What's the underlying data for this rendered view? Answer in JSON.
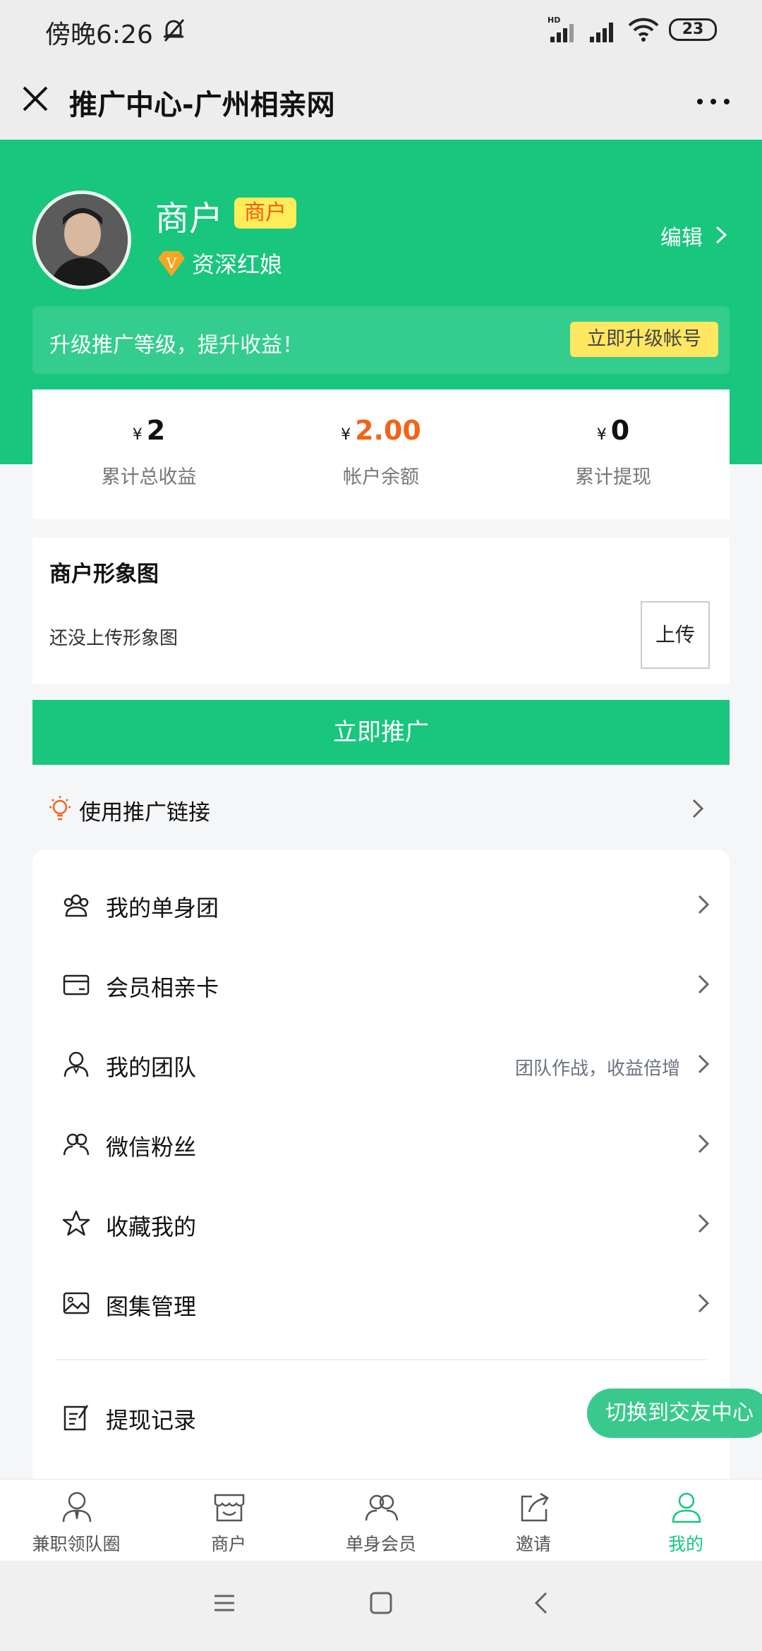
{
  "status_bar": {
    "time": "傍晚6:26",
    "battery": "23",
    "network": "HD"
  },
  "title_bar": {
    "title": "推广中心-广州相亲网"
  },
  "profile": {
    "name": "商户",
    "tag": "商户",
    "level": "资深红娘",
    "vip_badge": "V",
    "edit_label": "编辑"
  },
  "upgrade": {
    "text": "升级推广等级，提升收益！",
    "button": "立即升级帐号"
  },
  "stats": [
    {
      "currency": "¥",
      "value": "2",
      "label": "累计总收益"
    },
    {
      "currency": "¥",
      "value": "2.00",
      "label": "帐户余额"
    },
    {
      "currency": "¥",
      "value": "0",
      "label": "累计提现"
    }
  ],
  "merchant_image": {
    "title": "商户形象图",
    "empty_text": "还没上传形象图",
    "upload_button": "上传"
  },
  "promote_button": "立即推广",
  "promote_link": {
    "label": "使用推广链接",
    "icon": "lightbulb-icon"
  },
  "menu": [
    {
      "label": "我的单身团",
      "icon": "group-icon",
      "hint": ""
    },
    {
      "label": "会员相亲卡",
      "icon": "card-icon",
      "hint": ""
    },
    {
      "label": "我的团队",
      "icon": "team-icon",
      "hint": "团队作战，收益倍增"
    },
    {
      "label": "微信粉丝",
      "icon": "fans-icon",
      "hint": ""
    },
    {
      "label": "收藏我的",
      "icon": "star-icon",
      "hint": ""
    },
    {
      "label": "图集管理",
      "icon": "image-icon",
      "hint": ""
    },
    {
      "label": "提现记录",
      "icon": "record-icon",
      "hint": ""
    }
  ],
  "switch_button": "切换到交友中心",
  "tabs": [
    {
      "label": "兼职领队圈",
      "icon": "leader-icon",
      "active": false
    },
    {
      "label": "商户",
      "icon": "shop-icon",
      "active": false
    },
    {
      "label": "单身会员",
      "icon": "members-icon",
      "active": false
    },
    {
      "label": "邀请",
      "icon": "share-icon",
      "active": false
    },
    {
      "label": "我的",
      "icon": "profile-icon",
      "active": true
    }
  ],
  "colors": {
    "brand_green": "#18c67e",
    "tag_yellow": "#ffec5a",
    "accent_orange": "#f36418"
  }
}
